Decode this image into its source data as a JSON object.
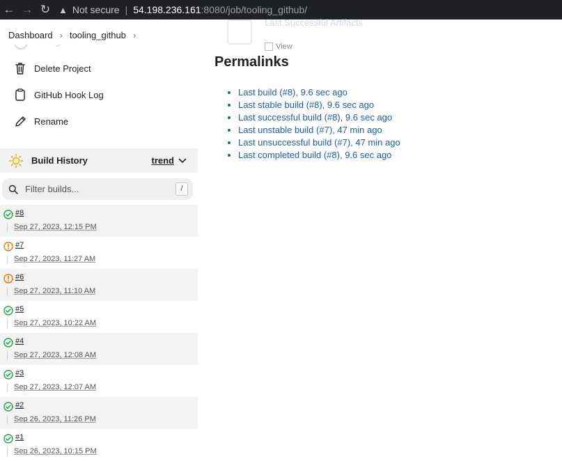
{
  "browser": {
    "back_icon": "arrow-left-icon",
    "forward_icon": "arrow-right-icon",
    "reload_icon": "reload-icon",
    "security_label": "Not secure",
    "url_host": "54.198.236.161",
    "url_rest": ":8080/job/tooling_github/"
  },
  "ghost": {
    "artifacts_label": "Last Successful Artifacts",
    "view_label": "View",
    "configure_label": "Configure"
  },
  "breadcrumb": {
    "items": [
      "Dashboard",
      "tooling_github"
    ]
  },
  "sidebar": {
    "tasks": [
      {
        "label": "Delete Project",
        "icon": "trash-icon"
      },
      {
        "label": "GitHub Hook Log",
        "icon": "clipboard-icon"
      },
      {
        "label": "Rename",
        "icon": "pencil-icon"
      }
    ]
  },
  "build_history": {
    "title": "Build History",
    "trend_label": "trend",
    "filter_placeholder": "Filter builds...",
    "shortcut_key": "/",
    "builds": [
      {
        "number": "#8",
        "date": "Sep 27, 2023, 12:15 PM",
        "status": "success"
      },
      {
        "number": "#7",
        "date": "Sep 27, 2023, 11:27 AM",
        "status": "unstable"
      },
      {
        "number": "#6",
        "date": "Sep 27, 2023, 11:10 AM",
        "status": "unstable"
      },
      {
        "number": "#5",
        "date": "Sep 27, 2023, 10:22 AM",
        "status": "success"
      },
      {
        "number": "#4",
        "date": "Sep 27, 2023, 12:08 AM",
        "status": "success"
      },
      {
        "number": "#3",
        "date": "Sep 27, 2023, 12:07 AM",
        "status": "success"
      },
      {
        "number": "#2",
        "date": "Sep 26, 2023, 11:26 PM",
        "status": "success"
      },
      {
        "number": "#1",
        "date": "Sep 26, 2023, 10:15 PM",
        "status": "success"
      }
    ]
  },
  "permalinks": {
    "title": "Permalinks",
    "links": [
      "Last build (#8), 9.6 sec ago",
      "Last stable build (#8), 9.6 sec ago",
      "Last successful build (#8), 9.6 sec ago",
      "Last unstable build (#7), 47 min ago",
      "Last unsuccessful build (#7), 47 min ago",
      "Last completed build (#8), 9.6 sec ago"
    ]
  },
  "colors": {
    "success": "#1ea64b",
    "unstable": "#e07b00",
    "link": "#1a5db3"
  }
}
